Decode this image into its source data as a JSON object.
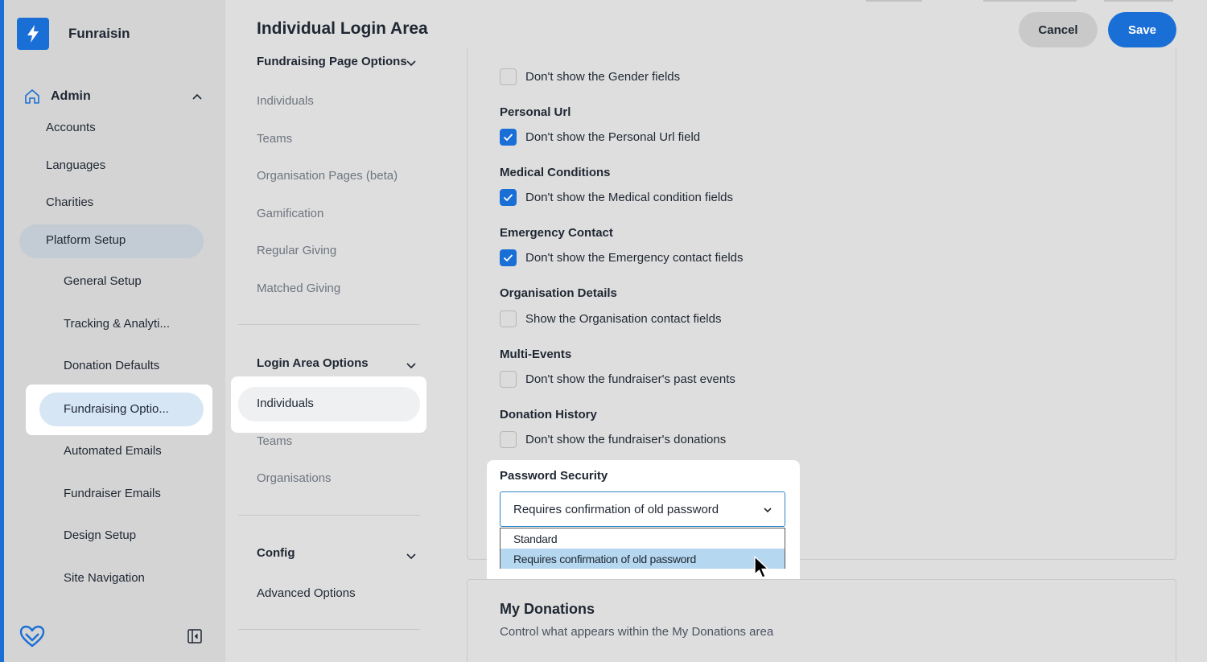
{
  "brand": {
    "name": "Funraisin",
    "accent": "#1a6fd6"
  },
  "sidebar": {
    "admin_label": "Admin",
    "level1": [
      "Accounts",
      "Languages",
      "Charities",
      "Platform Setup"
    ],
    "level2": [
      "General Setup",
      "Tracking & Analyti...",
      "Donation Defaults",
      "Fundraising Optio...",
      "Automated Emails",
      "Fundraiser Emails",
      "Design Setup",
      "Site Navigation"
    ]
  },
  "header": {
    "title": "Individual Login Area",
    "cancel_label": "Cancel",
    "save_label": "Save"
  },
  "subnav": {
    "section1": {
      "title": "Fundraising Page Options",
      "items": [
        "Individuals",
        "Teams",
        "Organisation Pages (beta)",
        "Gamification",
        "Regular Giving",
        "Matched Giving"
      ]
    },
    "section2": {
      "title": "Login Area Options",
      "items": [
        "Individuals",
        "Teams",
        "Organisations"
      ]
    },
    "section3": {
      "title": "Config",
      "items": [
        "Advanced Options"
      ]
    }
  },
  "settings": {
    "gender": {
      "option": "Don't show the Gender fields",
      "checked": false
    },
    "personal_url": {
      "label": "Personal Url",
      "option": "Don't show the Personal Url field",
      "checked": true
    },
    "medical": {
      "label": "Medical Conditions",
      "option": "Don't show the Medical condition fields",
      "checked": true
    },
    "emergency": {
      "label": "Emergency Contact",
      "option": "Don't show the Emergency contact fields",
      "checked": true
    },
    "organisation": {
      "label": "Organisation Details",
      "option": "Show the Organisation contact fields",
      "checked": false
    },
    "multi_events": {
      "label": "Multi-Events",
      "option": "Don't show the fundraiser's past events",
      "checked": false
    },
    "donation_history": {
      "label": "Donation History",
      "option": "Don't show the fundraiser's donations",
      "checked": false
    },
    "password": {
      "label": "Password Security",
      "selected": "Requires confirmation of old password",
      "options": [
        "Standard",
        "Requires confirmation of old password"
      ]
    }
  },
  "my_donations": {
    "title": "My Donations",
    "subtitle": "Control what appears within the My Donations area"
  }
}
